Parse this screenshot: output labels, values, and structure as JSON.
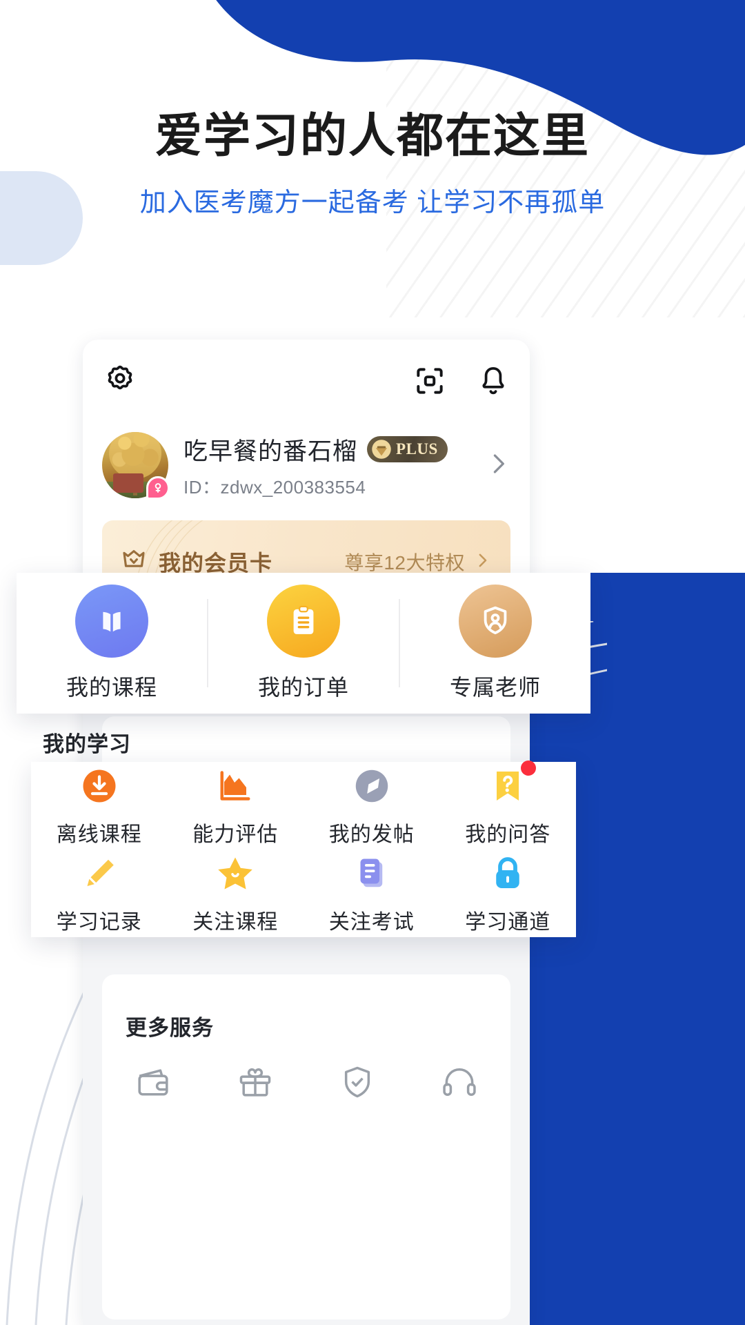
{
  "hero": {
    "headline": "爱学习的人都在这里",
    "subline": "加入医考魔方一起备考 让学习不再孤单",
    "headline_color": "#1b1b1b",
    "subline_color": "#2a6ae0",
    "blob_color": "#1340B0"
  },
  "phone": {
    "topbar": {
      "settings_icon": "gear-icon",
      "scan_icon": "scan-code-icon",
      "bell_icon": "bell-icon"
    },
    "profile": {
      "avatar_alt": "user-avatar-photo",
      "gender_icon": "female-gender-icon",
      "name": "吃早餐的番石榴",
      "plus_label": "PLUS",
      "user_id": "ID：zdwx_200383554",
      "chevron": "chevron-right-icon"
    },
    "vip_card": {
      "crown_icon": "crown-icon",
      "title": "我的会员卡",
      "link_text": "尊享12大特权",
      "chevron": "chevron-right-icon",
      "bg_color": "#f9e6cb",
      "text_color": "#8a6134"
    },
    "study_section": {
      "title": "我的学习"
    },
    "more_section": {
      "title": "更多服务",
      "items": [
        {
          "label": "",
          "icon": "wallet-icon"
        },
        {
          "label": "",
          "icon": "gift-icon"
        },
        {
          "label": "",
          "icon": "shield-check-icon"
        },
        {
          "label": "",
          "icon": "headset-icon"
        }
      ]
    }
  },
  "panel_quick": {
    "items": [
      {
        "label": "我的课程",
        "icon": "book-icon",
        "color": "#6e79f0"
      },
      {
        "label": "我的订单",
        "icon": "clipboard-icon",
        "color": "#f6a81f"
      },
      {
        "label": "专属老师",
        "icon": "teacher-shield-icon",
        "color": "#d59b5a"
      }
    ]
  },
  "panel_study": {
    "items": [
      {
        "label": "离线课程",
        "icon": "download-icon",
        "badge": false
      },
      {
        "label": "能力评估",
        "icon": "chart-icon",
        "badge": false
      },
      {
        "label": "我的发帖",
        "icon": "compass-icon",
        "badge": false
      },
      {
        "label": "我的问答",
        "icon": "question-bookmark-icon",
        "badge": true
      },
      {
        "label": "学习记录",
        "icon": "pencil-icon",
        "badge": false
      },
      {
        "label": "关注课程",
        "icon": "star-icon",
        "badge": false
      },
      {
        "label": "关注考试",
        "icon": "document-icon",
        "badge": false
      },
      {
        "label": "学习通道",
        "icon": "lock-icon",
        "badge": false
      }
    ]
  }
}
